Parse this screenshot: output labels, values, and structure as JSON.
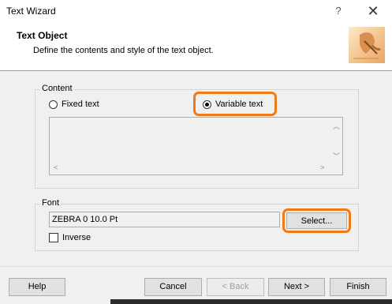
{
  "window": {
    "title": "Text Wizard",
    "help_glyph": "?",
    "close_glyph": "✕"
  },
  "header": {
    "title": "Text Object",
    "subtitle": "Define the contents and style of the text object.",
    "image_icon": "writing-hand-icon"
  },
  "content": {
    "group_label": "Content",
    "options": [
      {
        "label": "Fixed text",
        "selected": false
      },
      {
        "label": "Variable text",
        "selected": true
      }
    ],
    "text_value": ""
  },
  "font": {
    "group_label": "Font",
    "value": "ZEBRA 0 10.0 Pt",
    "select_label": "Select...",
    "inverse_label": "Inverse",
    "inverse_checked": false
  },
  "footer": {
    "help_label": "Help",
    "cancel_label": "Cancel",
    "back_label": "< Back",
    "next_label": "Next >",
    "finish_label": "Finish"
  },
  "colors": {
    "highlight": "#f07b16"
  }
}
